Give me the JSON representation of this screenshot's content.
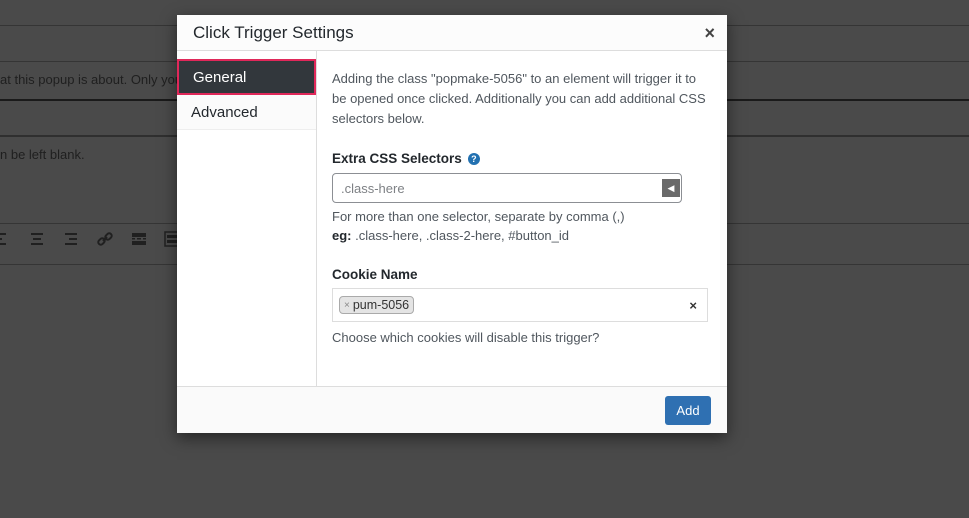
{
  "background": {
    "text_line_1": "at this popup is about. Only you",
    "text_line_2": "n be left blank.",
    "toolbar_icons": [
      "align-left-icon",
      "align-center-icon",
      "align-right-icon",
      "link-icon",
      "read-more-icon",
      "keyboard-icon"
    ]
  },
  "modal": {
    "title": "Click Trigger Settings",
    "close_label": "×",
    "tabs": [
      {
        "label": "General",
        "active": true
      },
      {
        "label": "Advanced",
        "active": false
      }
    ],
    "general": {
      "intro": "Adding the class \"popmake-5056\" to an element will trigger it to be opened once clicked. Additionally you can add additional CSS selectors below.",
      "extra_css": {
        "label": "Extra CSS Selectors",
        "help_icon": "?",
        "placeholder": ".class-here",
        "arrow": "◀",
        "desc_line_1": "For more than one selector, separate by comma (,)",
        "desc_eg_label": "eg:",
        "desc_eg_value": " .class-here, .class-2-here, #button_id"
      },
      "cookie_name": {
        "label": "Cookie Name",
        "selected": [
          {
            "label": "pum-5056",
            "remove": "×"
          }
        ],
        "clear": "×",
        "desc": "Choose which cookies will disable this trigger?"
      }
    },
    "footer": {
      "add_label": "Add"
    }
  },
  "colors": {
    "accent_blue": "#2f70b2",
    "active_tab_bg": "#32373c",
    "active_tab_border": "#e0285a"
  }
}
